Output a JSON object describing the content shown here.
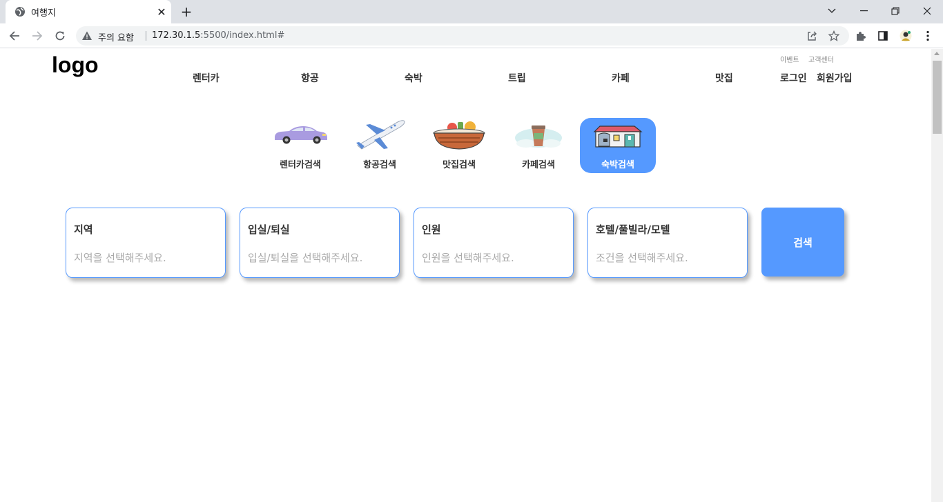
{
  "browser": {
    "tab_title": "여행지",
    "omnibox": {
      "security_label": "주의 요함",
      "url_host": "172.30.1.5",
      "url_rest": ":5500/index.html#"
    }
  },
  "header": {
    "logo": "logo",
    "util_links": [
      "이벤트",
      "고객센터"
    ],
    "nav": [
      "렌터카",
      "항공",
      "숙박",
      "트립",
      "카페",
      "맛집"
    ],
    "login": "로그인",
    "signup": "회원가입"
  },
  "categories": [
    {
      "label": "렌터카검색",
      "icon": "car-icon",
      "active": false
    },
    {
      "label": "항공검색",
      "icon": "airplane-icon",
      "active": false
    },
    {
      "label": "맛집검색",
      "icon": "food-basket-icon",
      "active": false
    },
    {
      "label": "카페검색",
      "icon": "coffee-cup-icon",
      "active": false
    },
    {
      "label": "숙박검색",
      "icon": "house-icon",
      "active": true
    }
  ],
  "search_fields": [
    {
      "title": "지역",
      "placeholder": "지역을 선택해주세요."
    },
    {
      "title": "입실/퇴실",
      "placeholder": "입실/퇴실을 선택해주세요."
    },
    {
      "title": "인원",
      "placeholder": "인원을 선택해주세요."
    },
    {
      "title": "호텔/풀빌라/모텔",
      "placeholder": "조건을 선택해주세요."
    }
  ],
  "search_button": "검색",
  "colors": {
    "accent": "#5599ff",
    "chrome_tabstrip": "#dee1e6",
    "placeholder_text": "#aaaaaa"
  }
}
